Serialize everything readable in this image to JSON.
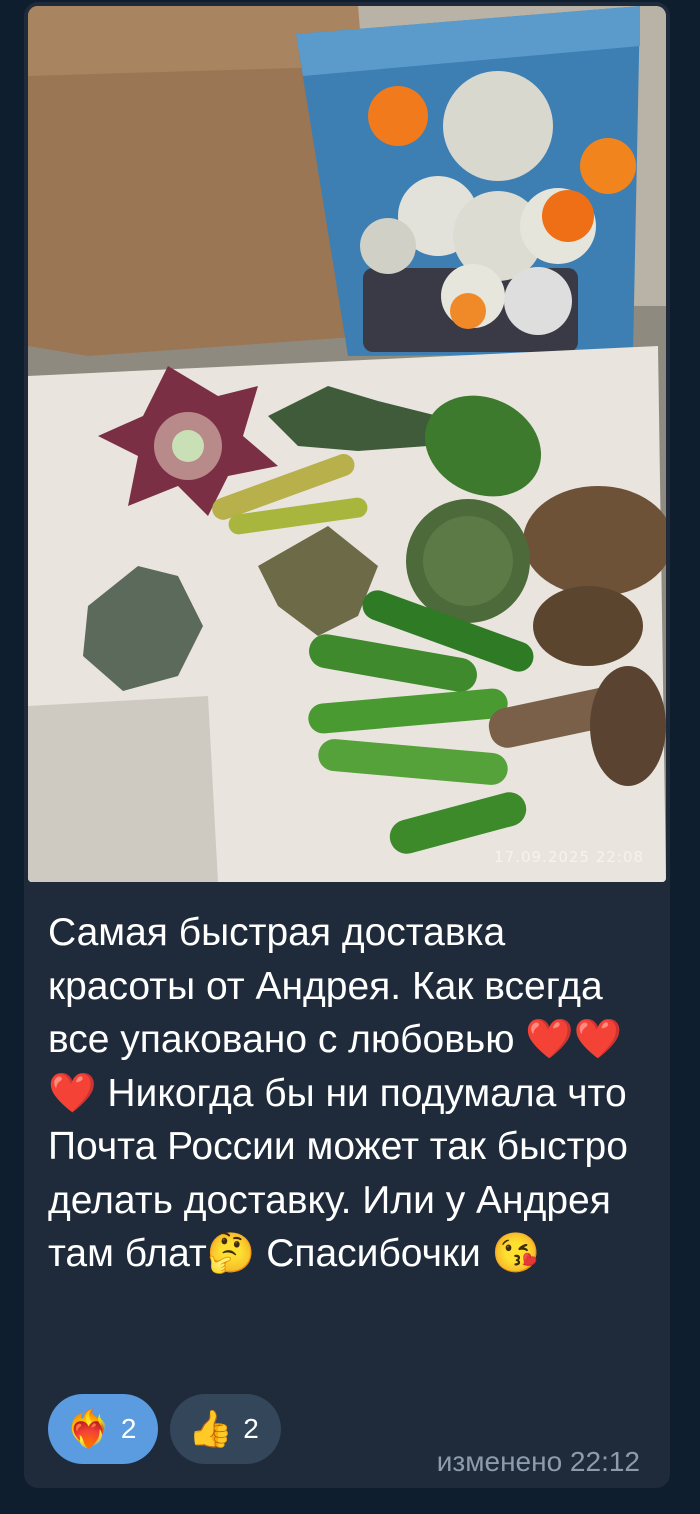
{
  "photo": {
    "overlay_timestamp": "17.09.2025 22:08",
    "alt": "succulents on paper"
  },
  "message": {
    "text": "Самая быстрая доставка красоты от Андрея. Как всегда все упаковано с любовью ❤️❤️❤️ Никогда бы ни подумала что Почта России может так быстро делать доставку. Или у Андрея там блат🤔 Спасибочки 😘",
    "edited_label": "изменено",
    "time": "22:12"
  },
  "reactions": [
    {
      "emoji": "❤️‍🔥",
      "icon": "heart-on-fire-icon",
      "count": "2",
      "selected": true
    },
    {
      "emoji": "👍",
      "icon": "thumbs-up-icon",
      "count": "2",
      "selected": false
    }
  ],
  "colors": {
    "bubble": "#1f2b3a",
    "reaction_selected": "#5b9be0",
    "reaction_default": "#34465a"
  }
}
